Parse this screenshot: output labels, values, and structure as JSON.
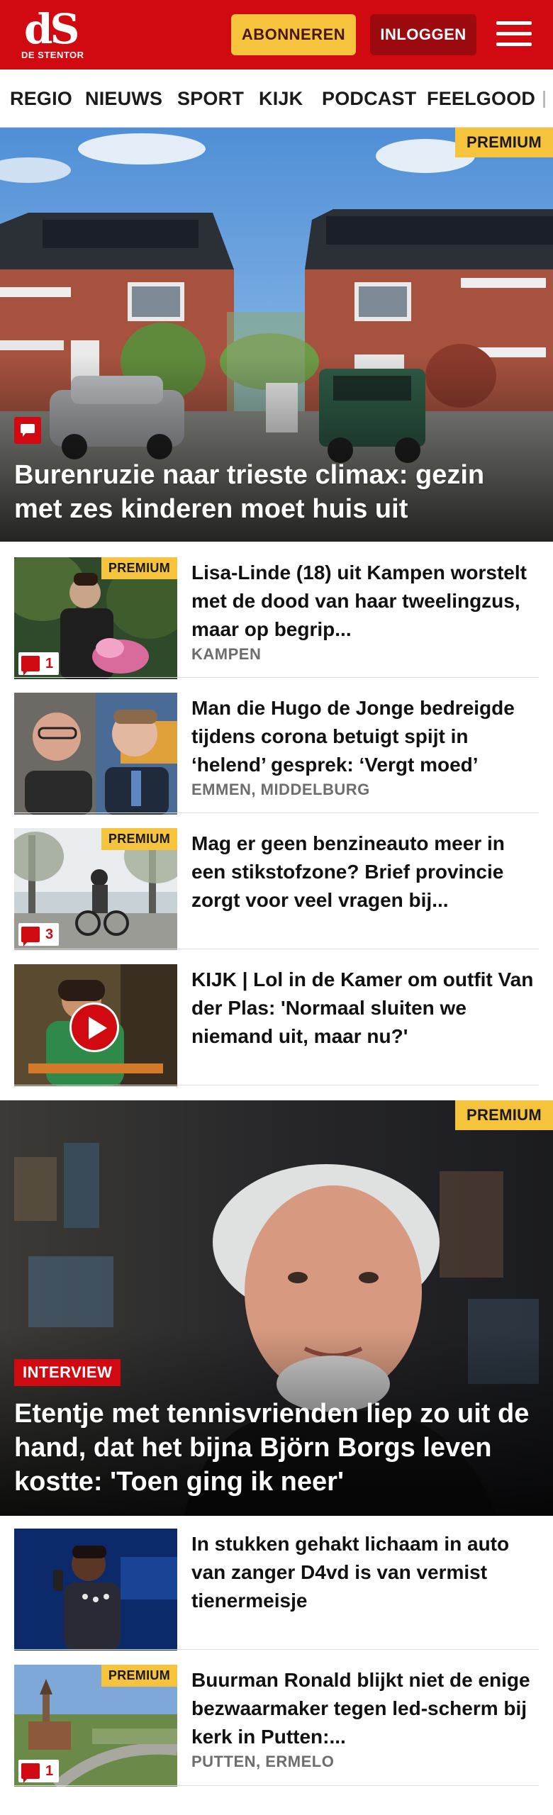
{
  "header": {
    "logo_mark": "dS",
    "logo_text": "DE STENTOR",
    "subscribe_label": "ABONNEREN",
    "login_label": "INLOGGEN"
  },
  "nav": {
    "items": [
      "REGIO",
      "NIEUWS",
      "SPORT",
      "KIJK",
      "PODCAST",
      "FEELGOOD"
    ]
  },
  "hero1": {
    "badge": "PREMIUM",
    "title": "Burenruzie naar trieste climax: gezin met zes kinderen moet huis uit",
    "has_comments": true
  },
  "articles": [
    {
      "premium": "PREMIUM",
      "comments": "1",
      "title": "Lisa-Linde (18) uit Kampen worstelt met de dood van haar tweelingzus, maar op begrip...",
      "meta": "KAMPEN"
    },
    {
      "premium": "",
      "comments": "",
      "title": "Man die Hugo de Jonge bedreigde tijdens corona betuigt spijt in ‘helend’ gesprek: ‘Vergt moed’",
      "meta": "EMMEN, MIDDELBURG"
    },
    {
      "premium": "PREMIUM",
      "comments": "3",
      "title": "Mag er geen benzineauto meer in een stikstofzone? Brief provincie zorgt voor veel vragen bij...",
      "meta": ""
    },
    {
      "premium": "",
      "comments": "",
      "title": "KIJK | Lol in de Kamer om outfit Van der Plas: 'Normaal sluiten we niemand uit, maar nu?'",
      "meta": ""
    }
  ],
  "hero2": {
    "badge": "PREMIUM",
    "tag": "INTERVIEW",
    "title": "Etentje met tennisvrienden liep zo uit de hand, dat het bijna Björn Borgs leven kostte: 'Toen ging ik neer'"
  },
  "articles2": [
    {
      "premium": "",
      "comments": "",
      "title": "In stukken gehakt lichaam in auto van zanger D4vd is van vermist tienermeisje",
      "meta": ""
    },
    {
      "premium": "PREMIUM",
      "comments": "1",
      "title": "Buurman Ronald blijkt niet de enige bezwaarmaker tegen led-scherm bij kerk in Putten:...",
      "meta": "PUTTEN, ERMELO"
    }
  ],
  "colors": {
    "brand_red": "#d10a11",
    "premium_yellow": "#f6c33c",
    "login_dark_red": "#9c0a0f"
  },
  "icons": {
    "menu": "hamburger-menu-icon",
    "comment": "comment-bubble-icon",
    "video": "play-icon"
  }
}
